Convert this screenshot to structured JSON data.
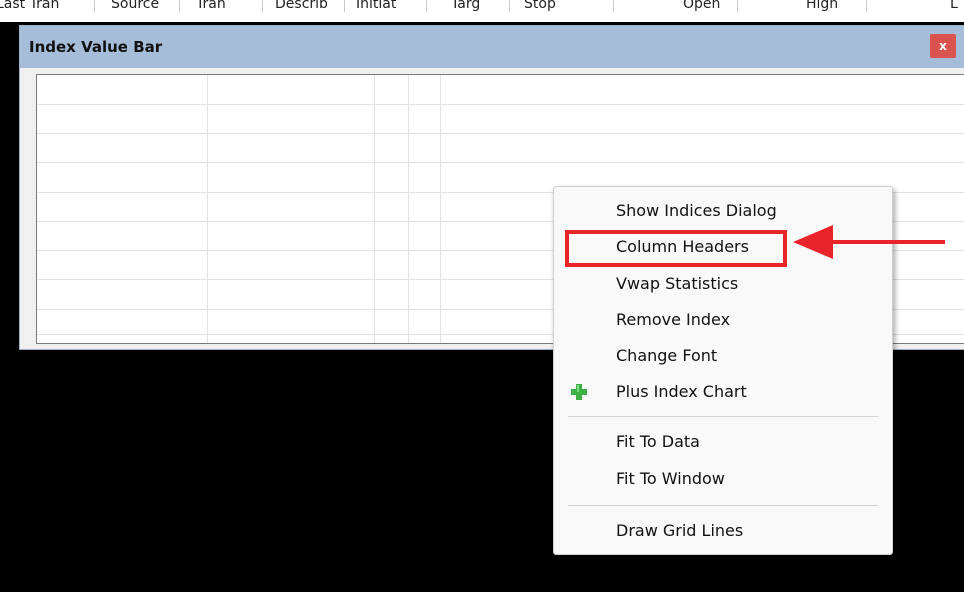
{
  "background_grid": {
    "columns": [
      "Last Tran",
      "Source",
      "Tran",
      "Describ",
      "Initiat",
      "Targ",
      "Stop",
      "Open",
      "High",
      "L"
    ]
  },
  "window": {
    "title": "Index Value Bar",
    "close_label": "x"
  },
  "context_menu": {
    "items": [
      {
        "label": "Show Indices Dialog"
      },
      {
        "label": "Column Headers"
      },
      {
        "label": "Vwap Statistics"
      },
      {
        "label": "Remove Index"
      },
      {
        "label": "Change Font"
      },
      {
        "label": "Plus Index Chart",
        "icon": "plus-icon"
      },
      {
        "label": "Fit To Data"
      },
      {
        "label": "Fit To Window"
      },
      {
        "label": "Draw Grid Lines"
      }
    ]
  },
  "colors": {
    "titlebar": "#a5bdd8",
    "close_button": "#d9534f",
    "annotation_red": "#e8232a",
    "plus_icon_green": "#3cb043"
  }
}
